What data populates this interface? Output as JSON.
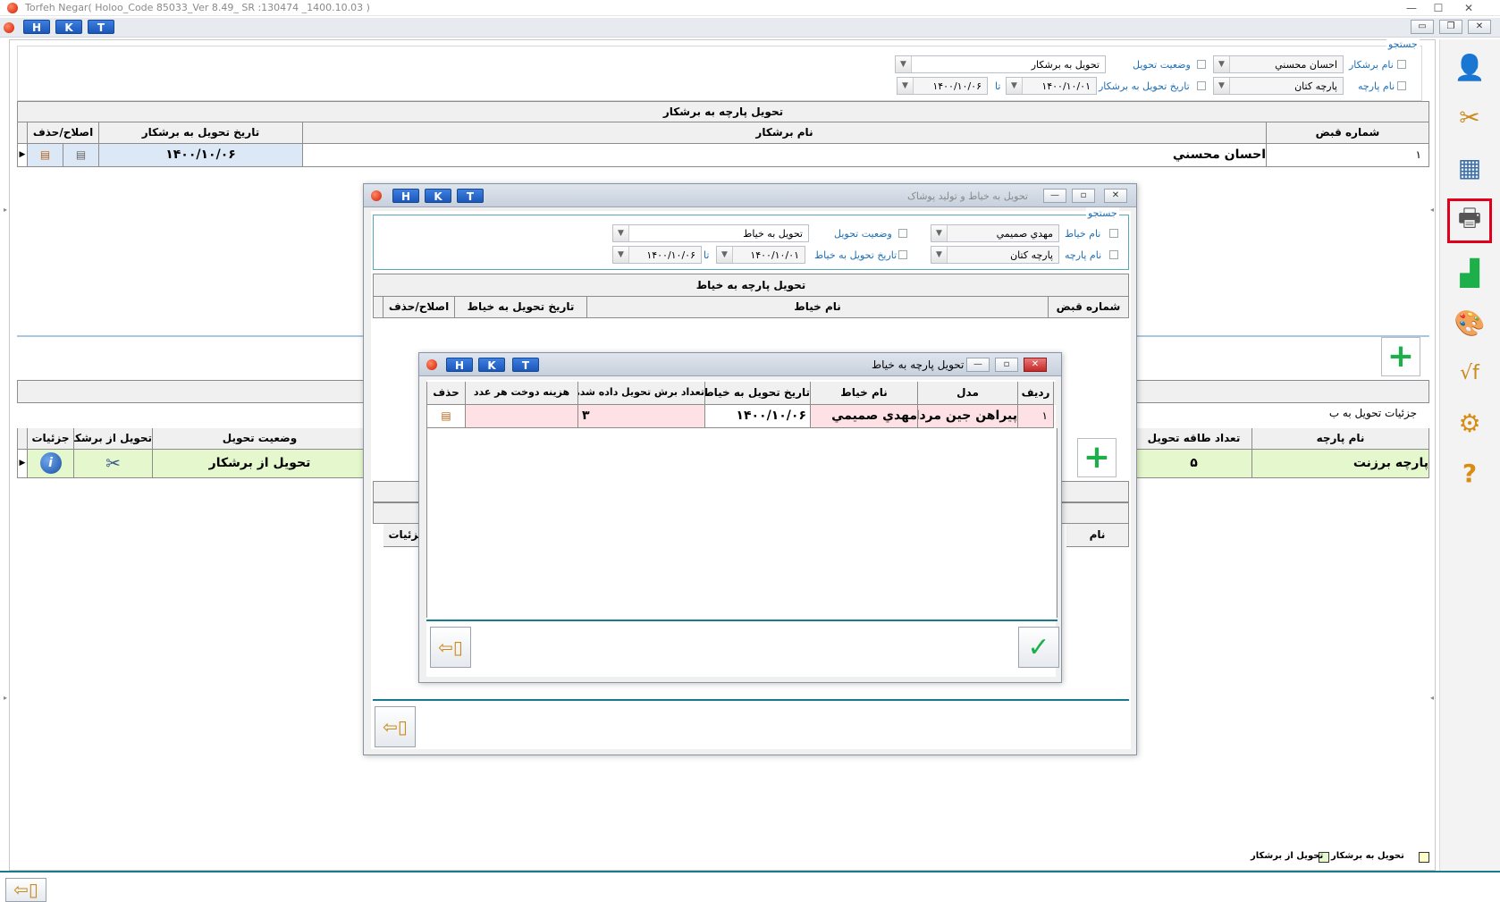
{
  "window": {
    "title": "Torfeh Negar( Holoo_Code  85033_Ver 8.49_ SR :130474 _1400.10.03 )"
  },
  "hkt": [
    "H",
    "K",
    "T"
  ],
  "main": {
    "search": {
      "legend": "جستجو",
      "label_cutter": "نام برشکار",
      "cutter_value": "احسان محسني",
      "label_fabric": "نام پارچه",
      "fabric_value": "پارچه کتان",
      "label_status": "وضعیت تحویل",
      "status_value": "تحویل به برشکار",
      "label_date": "تاریخ تحویل به برشکار",
      "date_from": "۱۴۰۰/۱۰/۰۱",
      "date_to_label": "تا",
      "date_to": "۱۴۰۰/۱۰/۰۶"
    },
    "grid1": {
      "title": "تحویل پارچه به برشکار",
      "columns": [
        "شماره قبض",
        "نام برشکار",
        "تاریخ تحویل به برشکار",
        "اصلاح/حذف"
      ],
      "rows": [
        {
          "receipt": "۱",
          "cutter": "احسان محسني",
          "date": "۱۴۰۰/۱۰/۰۶"
        }
      ]
    },
    "grid2": {
      "title": "جزئیات تحویل به ب",
      "columns": [
        "نام پارچه",
        "تعداد طاقه تحویل",
        "وضعیت تحویل",
        "تحویل از برشکار",
        "جزئیات"
      ],
      "rows": [
        {
          "fabric": "پارچه برزنت",
          "count": "۵",
          "status": "تحویل از برشکار"
        }
      ]
    },
    "legend_items": [
      "تحویل به برشکار",
      "تحویل از برشکار"
    ]
  },
  "dialog1": {
    "title": "تحویل به خیاط و تولید پوشاک",
    "search": {
      "legend": "جستجو",
      "label_tailor": "نام خیاط",
      "tailor_value": "مهدي صميمي",
      "label_fabric": "نام پارچه",
      "fabric_value": "پارچه کتان",
      "label_status": "وضعیت تحویل",
      "status_value": "تحویل به خیاط",
      "label_date": "تاریخ تحویل به خیاط",
      "date_from": "۱۴۰۰/۱۰/۰۱",
      "date_to_label": "تا",
      "date_to": "۱۴۰۰/۱۰/۰۶"
    },
    "grid": {
      "title": "تحویل پارچه به خیاط",
      "columns": [
        "شماره قبض",
        "نام خیاط",
        "تاریخ تحویل به خیاط",
        "اصلاح/حذف"
      ]
    },
    "grid2_columns": [
      "نام",
      "جزئیات"
    ]
  },
  "dialog2": {
    "title": "تحویل پارچه به خیاط",
    "columns": [
      "ردیف",
      "مدل",
      "نام خیاط",
      "تاریخ تحویل به خیاط",
      "تعداد برش تحویل داده شده",
      "هزینه دوخت هر عدد",
      "حذف"
    ],
    "rows": [
      {
        "row": "۱",
        "model": "پیراهن جین مردانه",
        "tailor": "مهدي صميمي",
        "date": "۱۴۰۰/۱۰/۰۶",
        "qty": "۳",
        "cost": ""
      }
    ]
  },
  "colors": {
    "accent": "#1f6fb5",
    "teal": "#197a8a",
    "selected_border": "#e0001b",
    "add_green": "#1db04a"
  }
}
